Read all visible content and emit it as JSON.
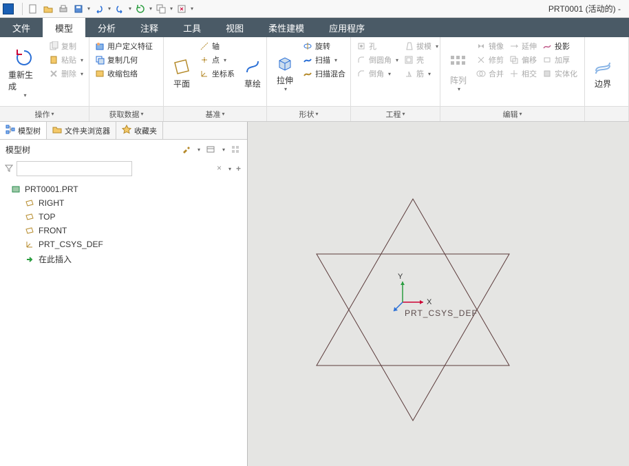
{
  "window": {
    "title": "PRT0001 (活动的) -"
  },
  "ribbon_tabs": {
    "file": "文件",
    "model": "模型",
    "analysis": "分析",
    "annotate": "注释",
    "tools": "工具",
    "view": "视图",
    "flex": "柔性建模",
    "apps": "应用程序"
  },
  "ribbon": {
    "regen": "重新生成",
    "copy": "复制",
    "paste": "粘贴",
    "delete": "删除",
    "udf": "用户定义特征",
    "copy_geom": "复制几何",
    "shrinkwrap": "收缩包络",
    "plane": "平面",
    "axis": "轴",
    "point": "点",
    "csys": "坐标系",
    "sketch": "草绘",
    "extrude": "拉伸",
    "revolve": "旋转",
    "sweep": "扫描",
    "swept_blend": "扫描混合",
    "hole": "孔",
    "round": "倒圆角",
    "chamfer": "倒角",
    "draft": "拔模",
    "shell": "壳",
    "rib": "筋",
    "pattern": "阵列",
    "mirror": "镜像",
    "trim": "修剪",
    "merge": "合并",
    "extend": "延伸",
    "offset": "偏移",
    "intersect": "相交",
    "thicken": "加厚",
    "solidify": "实体化",
    "project": "投影",
    "boundary": "边界"
  },
  "ribbon_groups": {
    "operate": "操作",
    "get_data": "获取数据",
    "datum": "基准",
    "shapes": "形状",
    "engineering": "工程",
    "edit": "编辑"
  },
  "sidebar": {
    "tabs": {
      "model_tree": "模型树",
      "folder_browser": "文件夹浏览器",
      "favorites": "收藏夹"
    },
    "header": "模型树",
    "filter_placeholder": "",
    "tree": {
      "root": "PRT0001.PRT",
      "right": "RIGHT",
      "top": "TOP",
      "front": "FRONT",
      "csys": "PRT_CSYS_DEF",
      "insert_here": "在此插入"
    }
  },
  "canvas": {
    "csys_label": "PRT_CSYS_DEF",
    "axis_x": "X",
    "axis_y": "Y"
  }
}
